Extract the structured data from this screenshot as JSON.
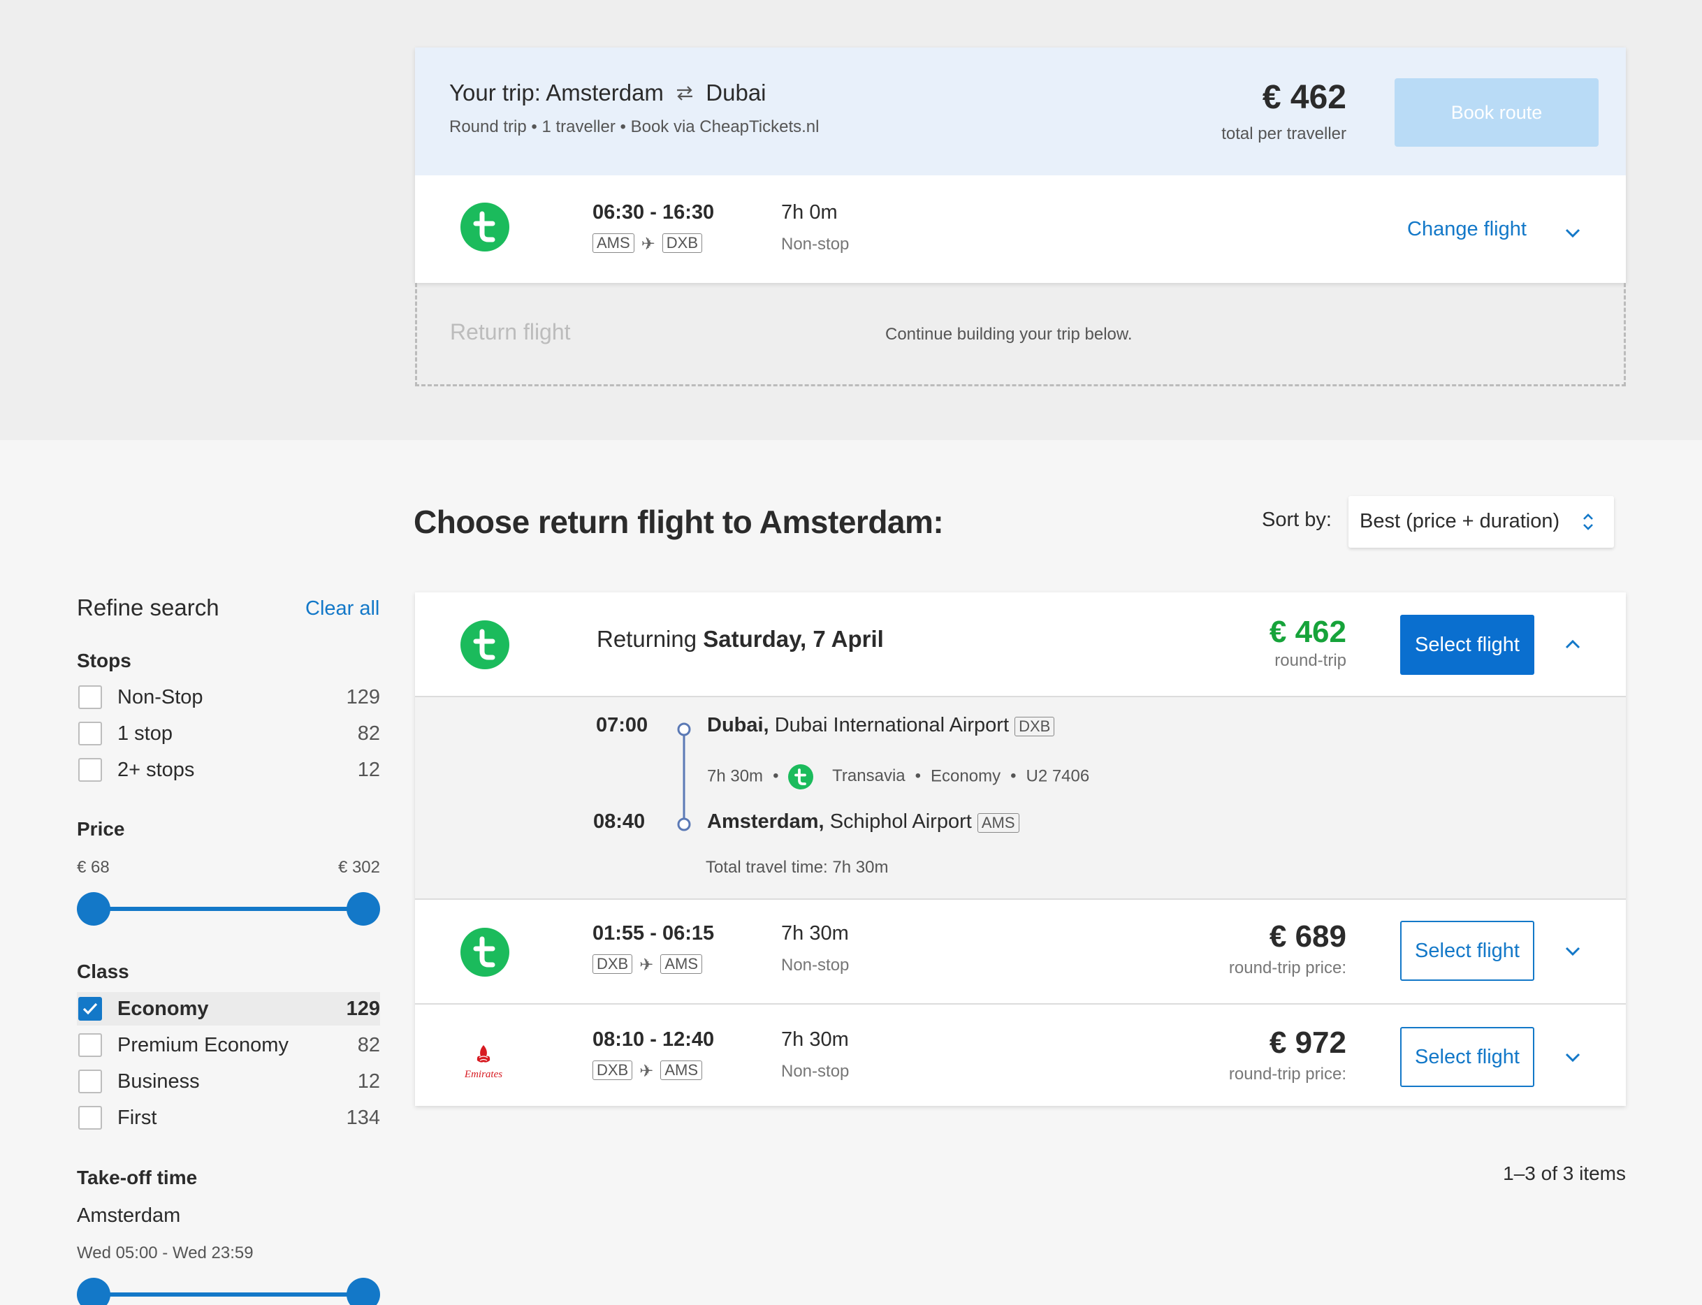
{
  "trip": {
    "title_prefix": "Your trip:",
    "from": "Amsterdam",
    "to": "Dubai",
    "subtitle": "Round trip • 1 traveller • Book via CheapTickets.nl",
    "price": "€ 462",
    "price_label": "total per traveller",
    "book_label": "Book route",
    "outbound": {
      "airline_icon": "transavia-logo",
      "times": "06:30 - 16:30",
      "from_code": "AMS",
      "to_code": "DXB",
      "duration": "7h 0m",
      "stops": "Non-stop",
      "change_label": "Change flight"
    },
    "return_label": "Return flight",
    "return_hint": "Continue building your trip below."
  },
  "main": {
    "heading": "Choose return flight to Amsterdam:",
    "sort_label": "Sort by:",
    "sort_value": "Best (price + duration)"
  },
  "sidebar": {
    "title": "Refine search",
    "clear_all": "Clear all",
    "stops": {
      "heading": "Stops",
      "items": [
        {
          "label": "Non-Stop",
          "count": "129",
          "checked": false
        },
        {
          "label": "1 stop",
          "count": "82",
          "checked": false
        },
        {
          "label": "2+ stops",
          "count": "12",
          "checked": false
        }
      ]
    },
    "price": {
      "heading": "Price",
      "min": "€ 68",
      "max": "€ 302"
    },
    "class": {
      "heading": "Class",
      "items": [
        {
          "label": "Economy",
          "count": "129",
          "checked": true
        },
        {
          "label": "Premium Economy",
          "count": "82",
          "checked": false
        },
        {
          "label": "Business",
          "count": "12",
          "checked": false
        },
        {
          "label": "First",
          "count": "134",
          "checked": false
        }
      ]
    },
    "takeoff": {
      "heading": "Take-off time",
      "city": "Amsterdam",
      "range": "Wed 05:00 - Wed 23:59"
    }
  },
  "results": {
    "selected": {
      "returning_prefix": "Returning",
      "date": "Saturday, 7 April",
      "price": "€ 462",
      "price_label": "round-trip",
      "select_label": "Select flight",
      "depart_time": "07:00",
      "depart_city": "Dubai,",
      "depart_airport": "Dubai International Airport",
      "depart_code": "DXB",
      "duration": "7h 30m",
      "airline": "Transavia",
      "cabin": "Economy",
      "flight_no": "U2 7406",
      "arrive_time": "08:40",
      "arrive_city": "Amsterdam,",
      "arrive_airport": "Schiphol Airport",
      "arrive_code": "AMS",
      "total_time": "Total travel time: 7h 30m"
    },
    "rows": [
      {
        "airline_icon": "transavia-logo",
        "times": "01:55 - 06:15",
        "from_code": "DXB",
        "to_code": "AMS",
        "duration": "7h 30m",
        "stops": "Non-stop",
        "price": "€ 689",
        "price_label": "round-trip price:",
        "select_label": "Select flight"
      },
      {
        "airline_icon": "emirates-logo",
        "airline_logo_text": "Emirates",
        "times": "08:10 - 12:40",
        "from_code": "DXB",
        "to_code": "AMS",
        "duration": "7h 30m",
        "stops": "Non-stop",
        "price": "€ 972",
        "price_label": "round-trip price:",
        "select_label": "Select flight"
      }
    ],
    "pager": "1–3 of 3 items"
  },
  "colors": {
    "accent": "#1378c8",
    "price_green": "#16a33a",
    "transavia_green": "#1bbb5c",
    "emirates_red": "#d71a21"
  }
}
